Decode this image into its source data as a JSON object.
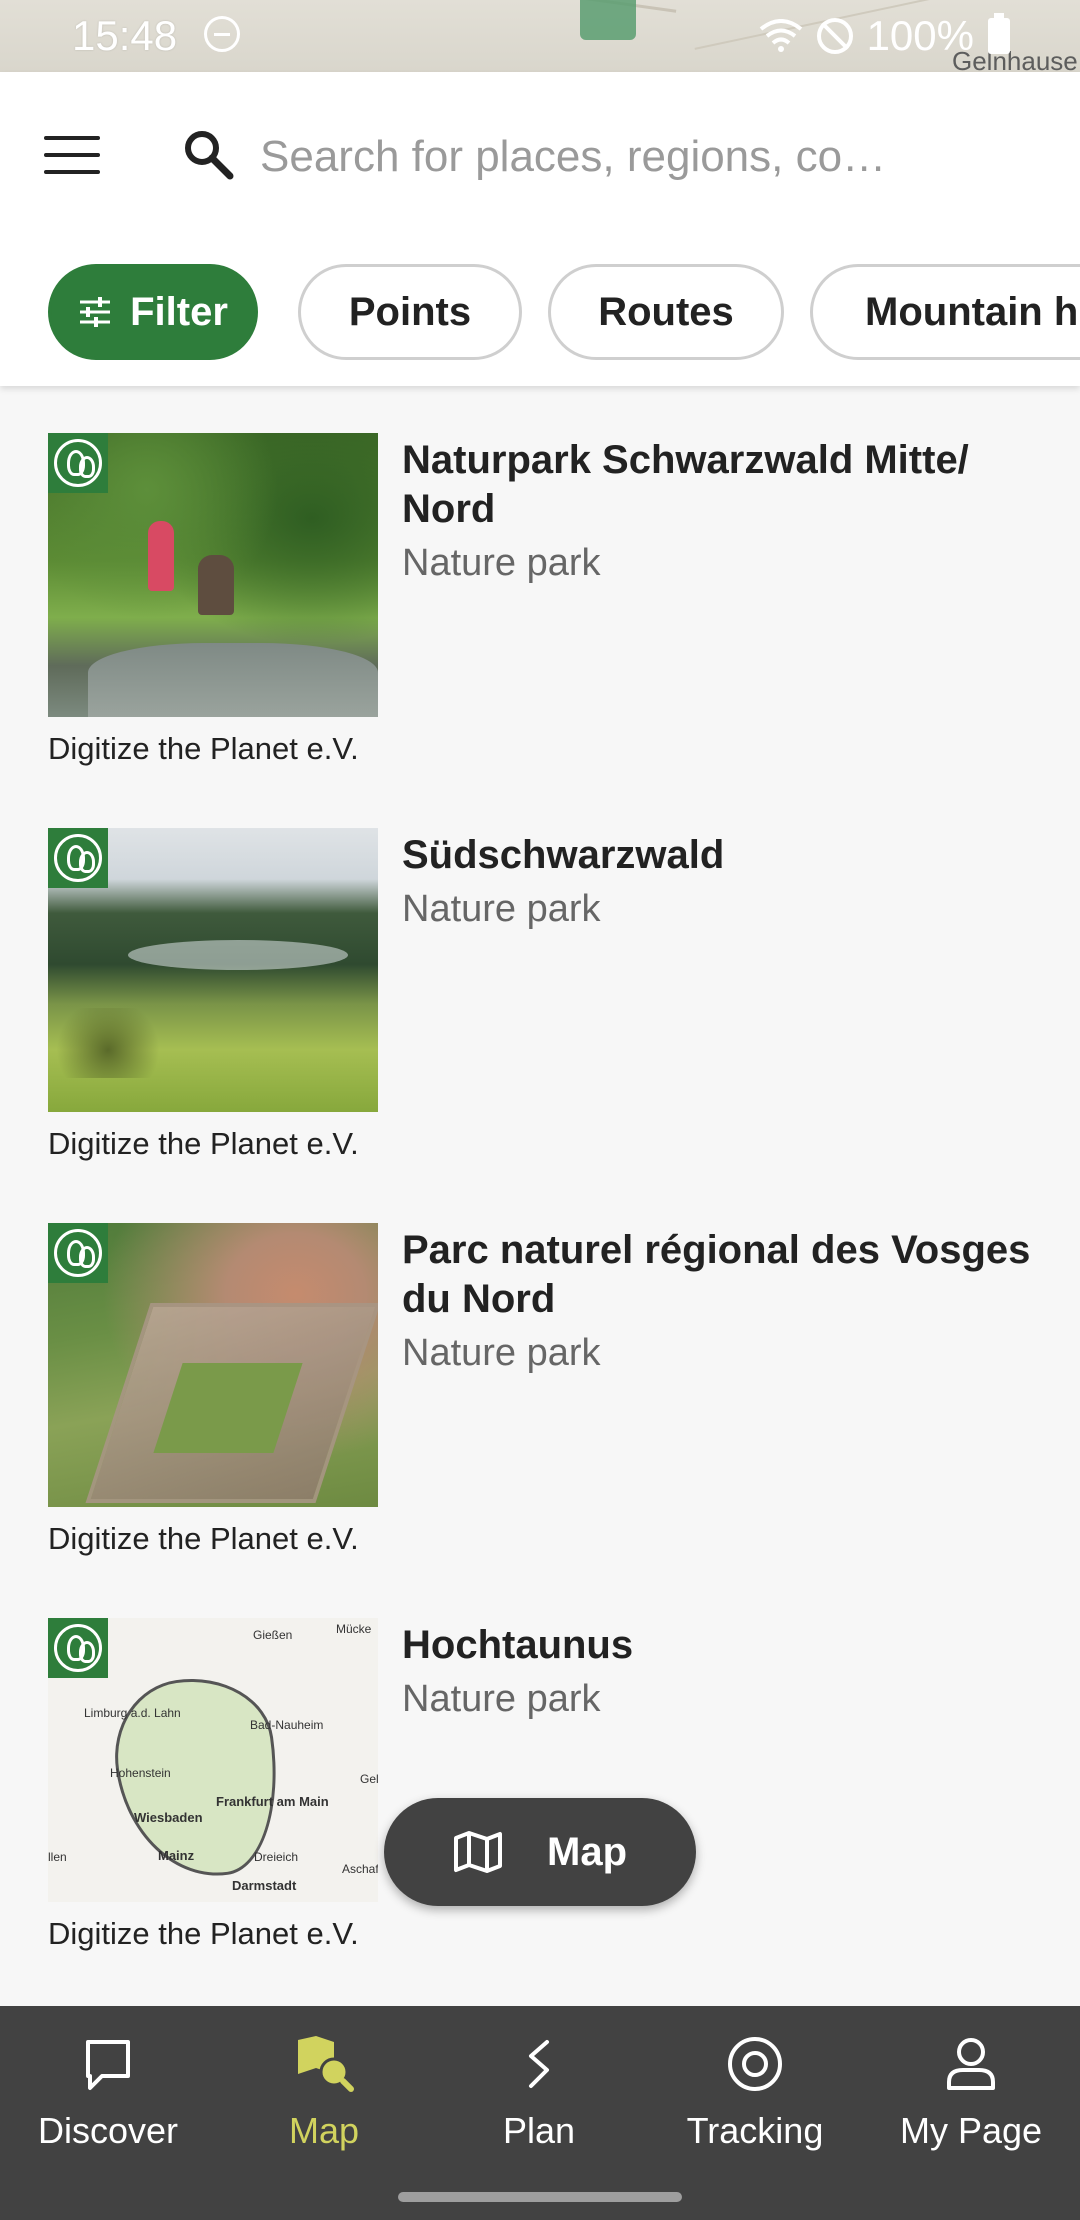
{
  "status_bar": {
    "time": "15:48",
    "battery": "100%",
    "map_town": "Gelnhause",
    "icons": [
      "dnd-icon",
      "wifi-icon",
      "block-icon",
      "battery-icon"
    ]
  },
  "header": {
    "search": {
      "placeholder": "Search for places, regions, co…"
    },
    "chips": [
      {
        "label": "Filter",
        "active": true,
        "icon": "filter-icon"
      },
      {
        "label": "Points"
      },
      {
        "label": "Routes"
      },
      {
        "label": "Mountain hu"
      }
    ]
  },
  "list": {
    "items": [
      {
        "title": "Naturpark Schwarzwald Mitte/ Nord",
        "subtitle": "Nature park",
        "credit": "Digitize the Planet e.V."
      },
      {
        "title": "Südschwarzwald",
        "subtitle": "Nature park",
        "credit": "Digitize the Planet e.V."
      },
      {
        "title": "Parc naturel régional des Vosges du Nord",
        "subtitle": "Nature park",
        "credit": "Digitize the Planet e.V."
      },
      {
        "title": "Hochtaunus",
        "subtitle": "Nature park",
        "credit": "Digitize the Planet e.V."
      }
    ],
    "map_labels": [
      "Gießen",
      "Mücke",
      "Limburg a.d. Lahn",
      "Bad-Nauheim",
      "Hohenstein",
      "Frankfurt am Main",
      "Wiesbaden",
      "Mainz",
      "Dreieich",
      "Darmstadt",
      "Aschaf",
      "llen",
      "Gel"
    ]
  },
  "map_fab": {
    "label": "Map",
    "icon": "map-icon"
  },
  "bottom_nav": {
    "items": [
      {
        "label": "Discover",
        "icon": "discover-icon"
      },
      {
        "label": "Map",
        "icon": "map-nav-icon",
        "active": true
      },
      {
        "label": "Plan",
        "icon": "plan-icon"
      },
      {
        "label": "Tracking",
        "icon": "tracking-icon"
      },
      {
        "label": "My Page",
        "icon": "profile-icon"
      }
    ]
  },
  "colors": {
    "brand_green": "#2e7d3b",
    "nav_background": "#424242",
    "nav_active": "#d1d35e"
  }
}
